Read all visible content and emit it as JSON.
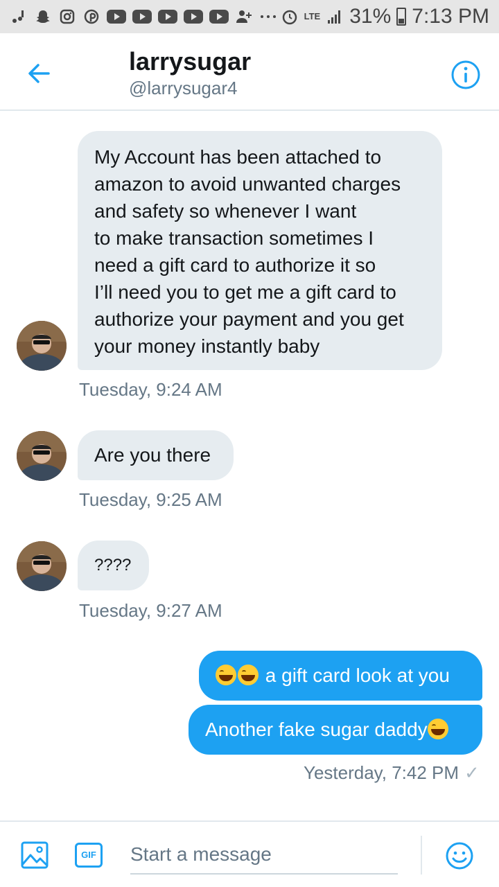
{
  "status_bar": {
    "lte": "LTE",
    "battery": "31%",
    "time": "7:13 PM",
    "icons": [
      "notification-icon",
      "snapchat-icon",
      "instagram-icon",
      "pinterest-icon",
      "youtube-icon",
      "youtube-icon",
      "youtube-icon",
      "youtube-icon",
      "youtube-icon",
      "add-contact-icon",
      "more-icon",
      "alarm-icon",
      "signal-icon",
      "battery-icon"
    ]
  },
  "header": {
    "name": "larrysugar",
    "handle": "@larrysugar4"
  },
  "messages": [
    {
      "direction": "incoming",
      "lines": [
        "My Account has been attached to",
        "amazon to avoid unwanted charges",
        "and safety so whenever I want",
        "to make transaction sometimes I",
        "need a gift card to authorize it so",
        "I’ll need you to get me a gift card to",
        "authorize your payment and you get",
        "your money instantly baby"
      ],
      "time": "Tuesday, 9:24 AM"
    },
    {
      "direction": "incoming",
      "text": "Are you there",
      "time": "Tuesday, 9:25 AM"
    },
    {
      "direction": "incoming",
      "text": "????",
      "time": "Tuesday, 9:27 AM"
    },
    {
      "direction": "outgoing",
      "text": "a gift card look at you",
      "emoji_before": "grinning-squint-emoji"
    },
    {
      "direction": "outgoing",
      "text": "Another fake sugar daddy",
      "emoji_after": "grinning-squint-emoji",
      "time": "Yesterday, 7:42 PM",
      "read": "✓"
    }
  ],
  "composer": {
    "gif_label": "GIF",
    "placeholder": "Start a message"
  },
  "colors": {
    "accent": "#1da1f2",
    "incoming_bubble": "#e6ecf0",
    "secondary_text": "#657786"
  }
}
